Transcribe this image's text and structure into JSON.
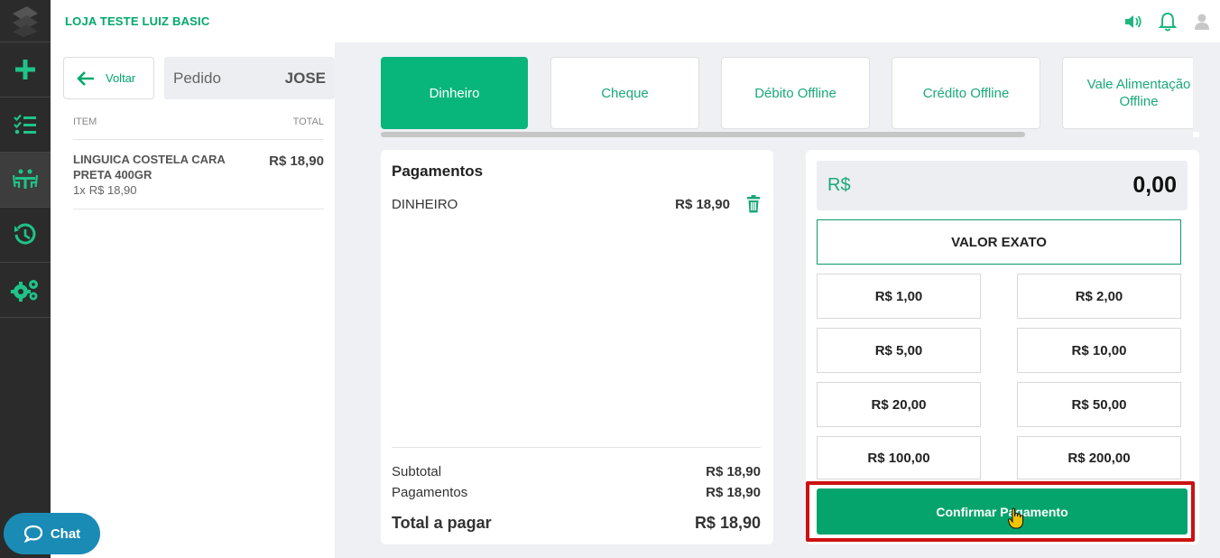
{
  "topbar": {
    "store_name": "LOJA TESTE LUIZ BASIC"
  },
  "sidebar": {
    "items": [
      {
        "name": "new-order",
        "icon": "plus-icon"
      },
      {
        "name": "checklist",
        "icon": "checklist-icon"
      },
      {
        "name": "tables",
        "icon": "dining-table-icon"
      },
      {
        "name": "history",
        "icon": "history-icon"
      },
      {
        "name": "settings",
        "icon": "gears-icon"
      }
    ]
  },
  "order": {
    "back_label": "Voltar",
    "pedido_label": "Pedido",
    "pedido_name": "JOSE",
    "col_item": "ITEM",
    "col_total": "TOTAL",
    "items": [
      {
        "name": "LINGUICA COSTELA CARA PRETA 400GR",
        "qty": "1x",
        "unit_price": "R$ 18,90",
        "total": "R$ 18,90"
      }
    ]
  },
  "chat": {
    "label": "Chat"
  },
  "tabs": [
    {
      "label": "Dinheiro",
      "active": true
    },
    {
      "label": "Cheque"
    },
    {
      "label": "Débito Offline"
    },
    {
      "label": "Crédito Offline"
    },
    {
      "label": "Vale Alimentação Offline"
    }
  ],
  "payments": {
    "title": "Pagamentos",
    "entries": [
      {
        "method": "DINHEIRO",
        "amount": "R$ 18,90"
      }
    ],
    "subtotal_label": "Subtotal",
    "subtotal_value": "R$ 18,90",
    "payments_label": "Pagamentos",
    "payments_value": "R$ 18,90",
    "total_label": "Total a pagar",
    "total_value": "R$ 18,90"
  },
  "cash": {
    "currency": "R$",
    "amount": "0,00",
    "exact_label": "VALOR EXATO",
    "quick_values": [
      "R$ 1,00",
      "R$ 2,00",
      "R$ 5,00",
      "R$ 10,00",
      "R$ 20,00",
      "R$ 50,00",
      "R$ 100,00",
      "R$ 200,00"
    ],
    "confirm_label": "Confirmar Pagamento"
  },
  "colors": {
    "accent": "#00a86b",
    "sidebar": "#2b2b2b",
    "highlight": "#cc1111"
  }
}
